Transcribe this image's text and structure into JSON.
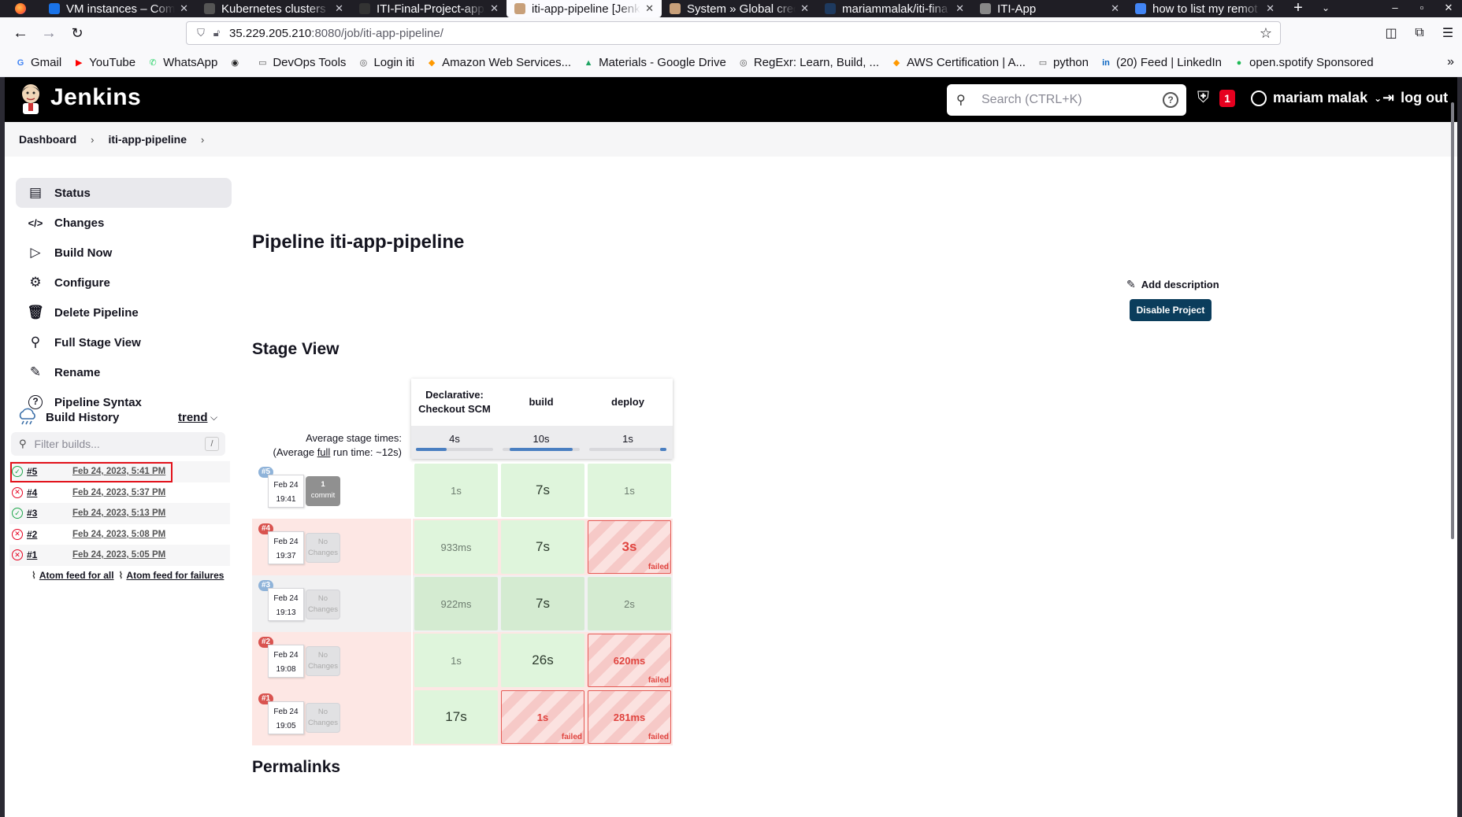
{
  "browser": {
    "tabs": [
      {
        "title": "VM instances – Comp",
        "icon_color": "#1a73e8"
      },
      {
        "title": "Kubernetes clusters",
        "icon_color": "#555"
      },
      {
        "title": "ITI-Final-Project-app/",
        "icon_color": "#333"
      },
      {
        "title": "iti-app-pipeline [Jenk",
        "icon_color": "#c8a07a",
        "active": true
      },
      {
        "title": "System » Global cred",
        "icon_color": "#c8a07a"
      },
      {
        "title": "mariammalak/iti-fina",
        "icon_color": "#1e3a5f"
      },
      {
        "title": "ITI-App",
        "icon_color": "#888"
      },
      {
        "title": "how to list my remot",
        "icon_color": "#4285f4"
      }
    ],
    "url_host": "35.229.205.210",
    "url_path": ":8080/job/iti-app-pipeline/",
    "bookmarks": [
      {
        "label": "Gmail",
        "icon": "G",
        "color": "#4285f4"
      },
      {
        "label": "YouTube",
        "icon": "▶",
        "color": "#ff0000"
      },
      {
        "label": "WhatsApp",
        "icon": "✆",
        "color": "#25d366"
      },
      {
        "label": "",
        "icon": "◉",
        "color": "#222"
      },
      {
        "label": "DevOps Tools",
        "icon": "▭",
        "color": "#555"
      },
      {
        "label": "Login iti",
        "icon": "◎",
        "color": "#555"
      },
      {
        "label": "Amazon Web Services...",
        "icon": "◆",
        "color": "#ff9900"
      },
      {
        "label": "Materials - Google Drive",
        "icon": "▲",
        "color": "#1fa463"
      },
      {
        "label": "RegExr: Learn, Build, ...",
        "icon": "◎",
        "color": "#555"
      },
      {
        "label": "AWS Certification | A...",
        "icon": "◆",
        "color": "#ff9900"
      },
      {
        "label": "python",
        "icon": "▭",
        "color": "#555"
      },
      {
        "label": "(20) Feed | LinkedIn",
        "icon": "in",
        "color": "#0a66c2"
      },
      {
        "label": "open.spotify Sponsored",
        "icon": "●",
        "color": "#1db954"
      }
    ]
  },
  "jenkins": {
    "brand": "Jenkins",
    "search_placeholder": "Search (CTRL+K)",
    "alert_count": "1",
    "user": "mariam malak",
    "logout": "log out",
    "breadcrumb": [
      "Dashboard",
      "iti-app-pipeline"
    ],
    "sidebar": [
      {
        "label": "Status",
        "icon": "status-icon",
        "active": true
      },
      {
        "label": "Changes",
        "icon": "code-icon"
      },
      {
        "label": "Build Now",
        "icon": "play-icon"
      },
      {
        "label": "Configure",
        "icon": "gear-icon"
      },
      {
        "label": "Delete Pipeline",
        "icon": "trash-icon"
      },
      {
        "label": "Full Stage View",
        "icon": "search-icon"
      },
      {
        "label": "Rename",
        "icon": "pencil-icon"
      },
      {
        "label": "Pipeline Syntax",
        "icon": "help-icon"
      }
    ],
    "build_history": {
      "title": "Build History",
      "trend": "trend",
      "filter_placeholder": "Filter builds...",
      "filter_key": "/",
      "builds": [
        {
          "num": "#5",
          "date": "Feb 24, 2023, 5:41 PM",
          "status": "success"
        },
        {
          "num": "#4",
          "date": "Feb 24, 2023, 5:37 PM",
          "status": "failed"
        },
        {
          "num": "#3",
          "date": "Feb 24, 2023, 5:13 PM",
          "status": "success"
        },
        {
          "num": "#2",
          "date": "Feb 24, 2023, 5:08 PM",
          "status": "failed"
        },
        {
          "num": "#1",
          "date": "Feb 24, 2023, 5:05 PM",
          "status": "failed"
        }
      ],
      "feed_all": "Atom feed for all",
      "feed_failures": "Atom feed for failures"
    },
    "main": {
      "title": "Pipeline iti-app-pipeline",
      "add_description": "Add description",
      "disable_project": "Disable Project",
      "stage_view_title": "Stage View",
      "permalinks_title": "Permalinks",
      "avg_line1": "Average stage times:",
      "avg_line2_pre": "(Average ",
      "avg_line2_link": "full",
      "avg_line2_post": " run time: ~12s)",
      "stages": [
        "Declarative: Checkout SCM",
        "build",
        "deploy"
      ],
      "stage_avgs": [
        {
          "time": "4s",
          "fill_pct": 40,
          "fill_offset_pct": 0
        },
        {
          "time": "10s",
          "fill_pct": 82,
          "fill_offset_pct": 9
        },
        {
          "time": "1s",
          "fill_pct": 8,
          "fill_offset_pct": 92
        }
      ],
      "runs": [
        {
          "badge": "#5",
          "date": "Feb 24",
          "time": "19:41",
          "changes": [
            "1",
            "commit"
          ],
          "changes_type": "commit",
          "row": "ok",
          "cells": [
            {
              "v": "1s",
              "s": "ok"
            },
            {
              "v": "7s",
              "s": "ok",
              "big": true
            },
            {
              "v": "1s",
              "s": "ok"
            }
          ]
        },
        {
          "badge": "#4",
          "date": "Feb 24",
          "time": "19:37",
          "changes": [
            "No",
            "Changes"
          ],
          "changes_type": "none",
          "row": "fail",
          "cells": [
            {
              "v": "933ms",
              "s": "ok"
            },
            {
              "v": "7s",
              "s": "ok",
              "big": true
            },
            {
              "v": "3s",
              "s": "failed",
              "big": true
            }
          ]
        },
        {
          "badge": "#3",
          "date": "Feb 24",
          "time": "19:13",
          "changes": [
            "No",
            "Changes"
          ],
          "changes_type": "none",
          "row": "okgray",
          "cells": [
            {
              "v": "922ms",
              "s": "okdark"
            },
            {
              "v": "7s",
              "s": "okdark",
              "big": true
            },
            {
              "v": "2s",
              "s": "okdark"
            }
          ]
        },
        {
          "badge": "#2",
          "date": "Feb 24",
          "time": "19:08",
          "changes": [
            "No",
            "Changes"
          ],
          "changes_type": "none",
          "row": "fail",
          "cells": [
            {
              "v": "1s",
              "s": "ok"
            },
            {
              "v": "26s",
              "s": "ok",
              "big": true
            },
            {
              "v": "620ms",
              "s": "failed"
            }
          ]
        },
        {
          "badge": "#1",
          "date": "Feb 24",
          "time": "19:05",
          "changes": [
            "No",
            "Changes"
          ],
          "changes_type": "none",
          "row": "fail",
          "cells": [
            {
              "v": "17s",
              "s": "ok",
              "big": true
            },
            {
              "v": "1s",
              "s": "failed"
            },
            {
              "v": "281ms",
              "s": "failed"
            }
          ]
        }
      ],
      "failed_label": "failed"
    }
  }
}
